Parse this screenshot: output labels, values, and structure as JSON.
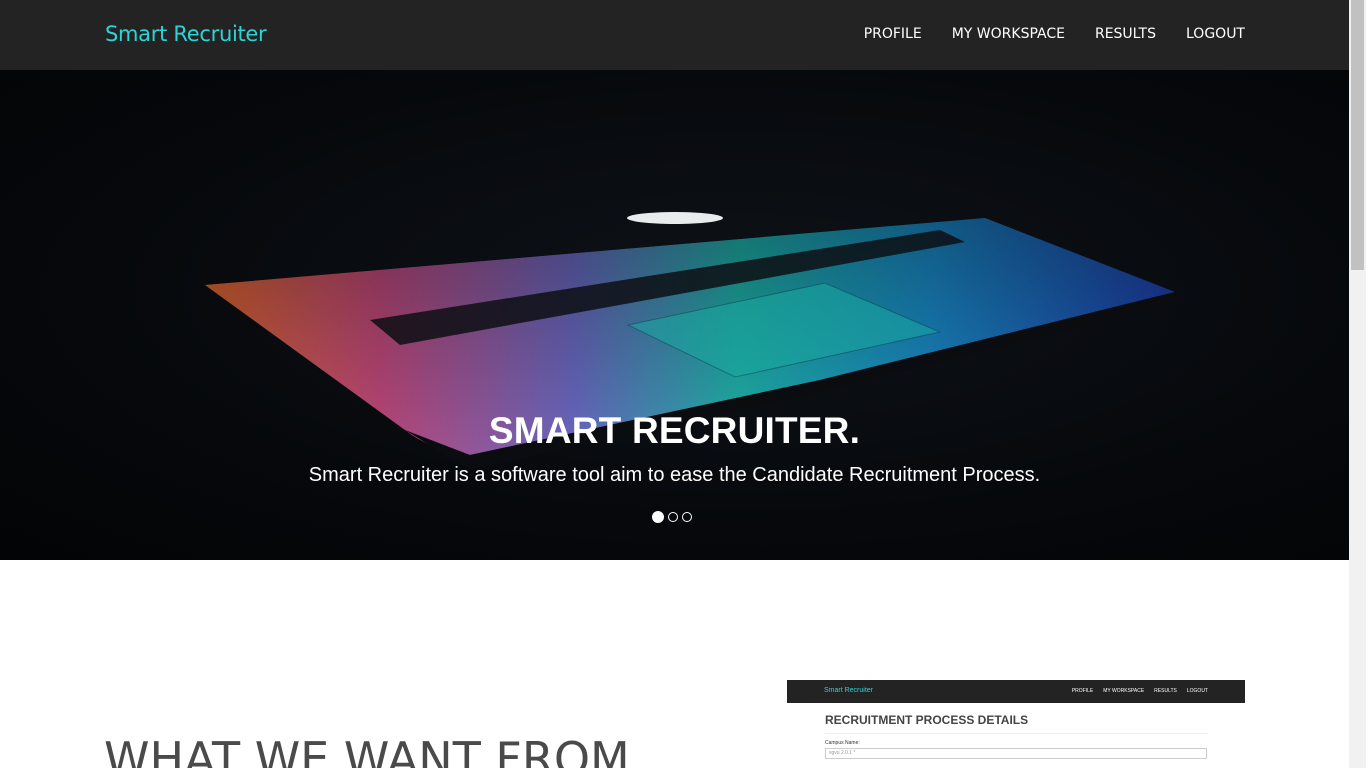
{
  "nav": {
    "brand": "Smart Recruiter",
    "items": [
      "PROFILE",
      "MY WORKSPACE",
      "RESULTS",
      "LOGOUT"
    ]
  },
  "hero": {
    "title": "SMART RECRUITER.",
    "subtitle": "Smart Recruiter is a software tool aim to ease the Candidate Recruitment Process.",
    "slide_count": 3,
    "active_slide": 1
  },
  "section": {
    "heading": "WHAT WE WANT FROM"
  },
  "preview": {
    "brand": "Smart Recruiter",
    "menu": [
      "PROFILE",
      "MY WORKSPACE",
      "RESULTS",
      "LOGOUT"
    ],
    "title": "RECRUITMENT PROCESS DETAILS",
    "field_label": "Campus Name:",
    "field_value": "sgvu 2.0.1 *"
  },
  "colors": {
    "brand": "#2ed3d6",
    "nav_bg": "#232323"
  }
}
